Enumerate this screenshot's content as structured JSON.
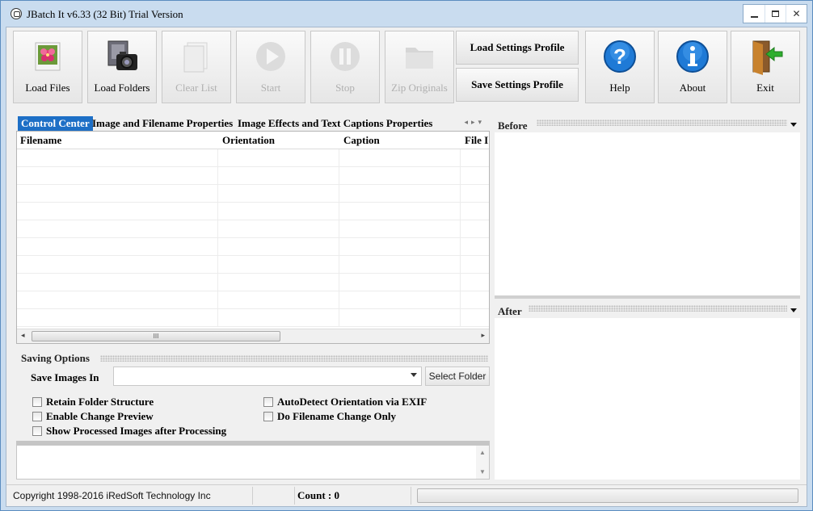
{
  "window": {
    "title": "JBatch It v6.33 (32 Bit) Trial Version",
    "close_glyph": "✕"
  },
  "toolbar": {
    "load_files": "Load Files",
    "load_folders": "Load Folders",
    "clear_list": "Clear List",
    "start": "Start",
    "stop": "Stop",
    "zip_originals": "Zip Originals",
    "load_settings_profile": "Load Settings Profile",
    "save_settings_profile": "Save Settings Profile",
    "help": "Help",
    "about": "About",
    "exit": "Exit"
  },
  "tabs": [
    {
      "label": "Control Center",
      "active": true
    },
    {
      "label": "Image and Filename Properties",
      "active": false
    },
    {
      "label": "Image Effects and Text Captions Properties",
      "active": false
    }
  ],
  "grid": {
    "columns": [
      "Filename",
      "Orientation",
      "Caption",
      "File I"
    ],
    "rows": [],
    "scroll_thumb_glyph": "III"
  },
  "saving_options": {
    "title": "Saving Options",
    "save_images_in_label": "Save Images In",
    "save_images_in_value": "",
    "select_folder": "Select Folder",
    "checkboxes": {
      "retain_folder_structure": {
        "label": "Retain Folder Structure",
        "checked": false
      },
      "enable_change_preview": {
        "label": "Enable Change Preview",
        "checked": false
      },
      "show_processed_images": {
        "label": "Show Processed Images after Processing",
        "checked": false
      },
      "autodetect_orientation": {
        "label": "AutoDetect Orientation via EXIF",
        "checked": false
      },
      "filename_change_only": {
        "label": "Do Filename Change Only",
        "checked": false
      }
    }
  },
  "preview": {
    "before_label": "Before",
    "after_label": "After"
  },
  "status": {
    "copyright": "Copyright 1998-2016 iRedSoft Technology Inc",
    "count": "Count : 0",
    "progress": 0
  },
  "colors": {
    "accent_tab": "#1d6fc6",
    "help_icon": "#1f7ad6",
    "about_icon": "#1f7ad6",
    "exit_arrow": "#2fae2f"
  }
}
